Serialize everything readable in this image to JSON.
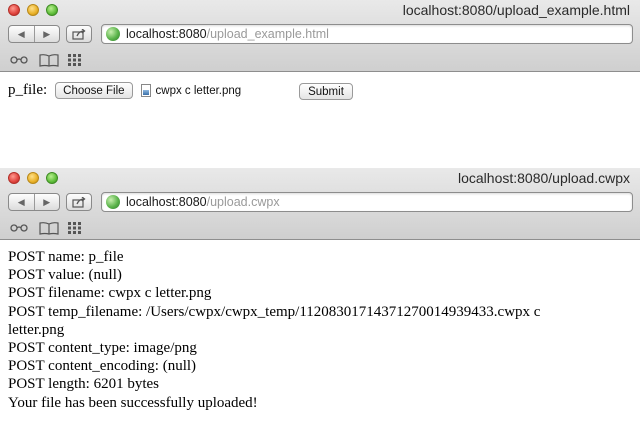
{
  "windows": [
    {
      "title": "localhost:8080/upload_example.html",
      "address": {
        "host": "localhost:8080",
        "path": "/upload_example.html"
      },
      "form": {
        "field_label": "p_file:",
        "choose_button": "Choose File",
        "selected_file": "cwpx c letter.png",
        "submit_button": "Submit"
      }
    },
    {
      "title": "localhost:8080/upload.cwpx",
      "address": {
        "host": "localhost:8080",
        "path": "/upload.cwpx"
      },
      "output_lines": [
        "POST name: p_file",
        "POST value: (null)",
        "POST filename: cwpx c letter.png",
        "POST temp_filename: /Users/cwpx/cwpx_temp/11208301714371270014939433.cwpx c",
        "letter.png",
        "POST content_type: image/png",
        "POST content_encoding: (null)",
        "POST length: 6201 bytes",
        "Your file has been successfully uploaded!"
      ]
    }
  ]
}
